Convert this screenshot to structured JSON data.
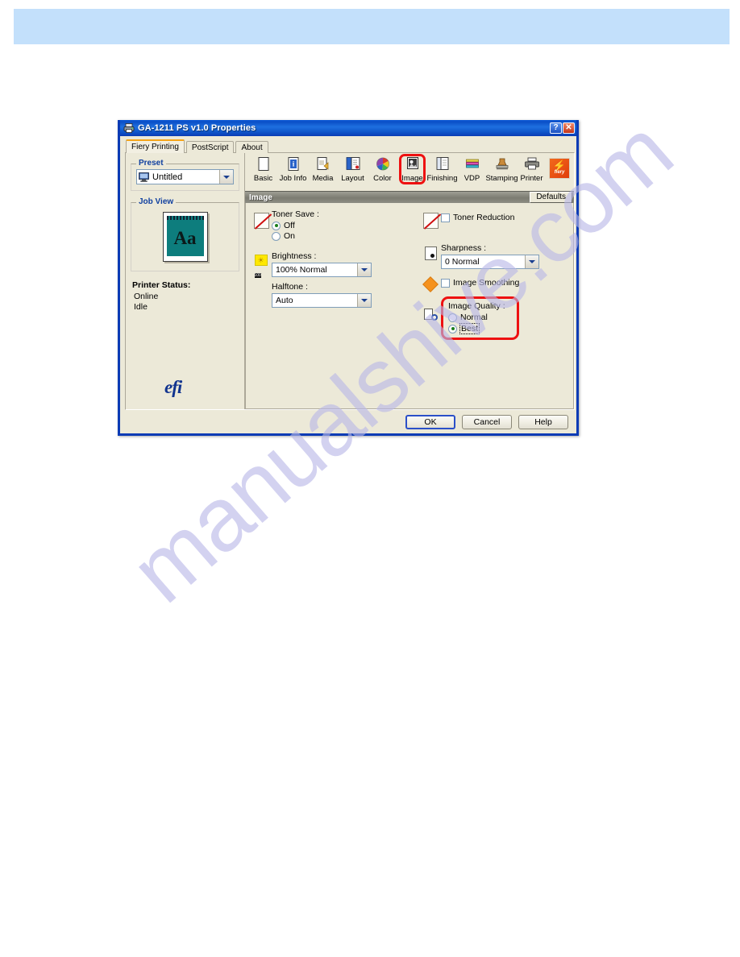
{
  "window": {
    "title": "GA-1211 PS v1.0 Properties",
    "icon": "printer-icon",
    "help_button": "?",
    "close_button": "✕"
  },
  "tabs": [
    {
      "label": "Fiery Printing",
      "active": true
    },
    {
      "label": "PostScript",
      "active": false
    },
    {
      "label": "About",
      "active": false
    }
  ],
  "sidebar": {
    "preset": {
      "legend": "Preset",
      "value": "Untitled",
      "icon": "monitor-icon"
    },
    "job_view": {
      "legend": "Job View",
      "preview_text": "Aa"
    },
    "printer_status": {
      "title": "Printer Status:",
      "lines": [
        "Online",
        "Idle"
      ]
    },
    "brand": "efi"
  },
  "toolbar": {
    "items": [
      {
        "label": "Basic",
        "icon": "page-icon",
        "highlighted": false
      },
      {
        "label": "Job Info",
        "icon": "info-page-icon",
        "highlighted": false
      },
      {
        "label": "Media",
        "icon": "media-page-icon",
        "highlighted": false
      },
      {
        "label": "Layout",
        "icon": "layout-page-icon",
        "highlighted": false
      },
      {
        "label": "Color",
        "icon": "color-wheel-icon",
        "highlighted": false
      },
      {
        "label": "Image",
        "icon": "image-icon",
        "highlighted": true
      },
      {
        "label": "Finishing",
        "icon": "finishing-icon",
        "highlighted": false
      },
      {
        "label": "VDP",
        "icon": "vdp-stack-icon",
        "highlighted": false
      },
      {
        "label": "Stamping",
        "icon": "stamp-icon",
        "highlighted": false
      },
      {
        "label": "Printer",
        "icon": "printer-icon",
        "highlighted": false
      }
    ],
    "brand_logo": {
      "icon": "fiery-logo-icon",
      "text": "fiery"
    }
  },
  "section": {
    "title": "Image",
    "defaults_button": "Defaults"
  },
  "settings": {
    "toner_save": {
      "label": "Toner Save :",
      "icon": "disabled-slash-icon",
      "options": [
        {
          "label": "Off",
          "selected": true
        },
        {
          "label": "On",
          "selected": false
        }
      ]
    },
    "brightness": {
      "label": "Brightness :",
      "icon": "brightness-icon",
      "value": "100% Normal"
    },
    "halftone": {
      "label": "Halftone :",
      "value": "Auto"
    },
    "toner_reduction": {
      "label": "Toner Reduction",
      "icon": "disabled-slash-icon",
      "checked": false
    },
    "sharpness": {
      "label": "Sharpness :",
      "icon": "sharpness-doc-icon",
      "value": "0 Normal"
    },
    "image_smoothing": {
      "label": "Image Smoothing",
      "icon": "orange-diamond-icon",
      "checked": false
    },
    "image_quality": {
      "label": "Image Quality :",
      "icon": "image-quality-icon",
      "highlighted": true,
      "options": [
        {
          "label": "Normal",
          "selected": false
        },
        {
          "label": "Best",
          "selected": true
        }
      ]
    }
  },
  "footer": {
    "ok": "OK",
    "cancel": "Cancel",
    "help": "Help"
  },
  "watermark": {
    "text": "manualshive.com"
  },
  "colors": {
    "accent_red": "#ee1111",
    "titlebar_blue": "#0a3bb5",
    "banner_blue": "#c3e0fb",
    "dialog_face": "#ece9d8",
    "brand_blue": "#11348f",
    "fiery_orange": "#e03c0c",
    "preview_teal": "#0d7d7d"
  }
}
